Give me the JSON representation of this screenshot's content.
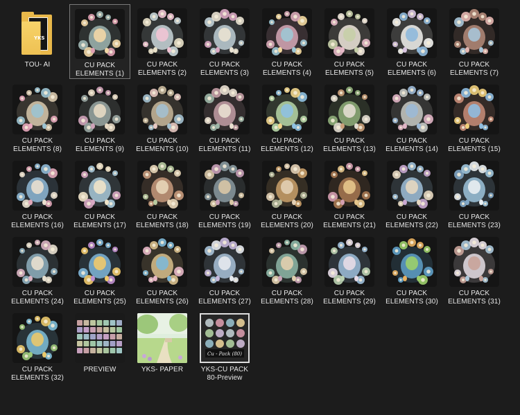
{
  "folder": {
    "items": [
      {
        "label": "TOU- AI",
        "type": "folder",
        "thumb": "folder-icon",
        "doc_text": "YKS"
      },
      {
        "label": "CU PACK\nELEMENTS  (1)",
        "type": "art",
        "thumb": "flower-boot-thumbnail",
        "selected": true,
        "colors": [
          "#9fb6b2",
          "#f2d7a6",
          "#e0a1b3"
        ]
      },
      {
        "label": "CU PACK\nELEMENTS  (2)",
        "type": "art",
        "thumb": "flower-vases-thumbnail",
        "colors": [
          "#c9d6d9",
          "#f0c4d4",
          "#e8e0c8"
        ]
      },
      {
        "label": "CU PACK\nELEMENTS  (3)",
        "type": "art",
        "thumb": "rocking-chair-thumbnail",
        "colors": [
          "#bfcfd6",
          "#e9e2d2",
          "#d9a8c3"
        ]
      },
      {
        "label": "CU PACK\nELEMENTS  (4)",
        "type": "art",
        "thumb": "flower-burst-thumbnail",
        "colors": [
          "#d7a8b7",
          "#9ec7d4",
          "#f3d9a0"
        ]
      },
      {
        "label": "CU PACK\nELEMENTS  (5)",
        "type": "art",
        "thumb": "flower-spray-thumbnail",
        "colors": [
          "#efe7dc",
          "#c6cfa8",
          "#e7b9c8"
        ]
      },
      {
        "label": "CU PACK\nELEMENTS  (6)",
        "type": "art",
        "thumb": "flower-bouquet-thumbnail",
        "colors": [
          "#f2f2ee",
          "#8fb9dc",
          "#d8c4e0"
        ]
      },
      {
        "label": "CU PACK\nELEMENTS  (7)",
        "type": "art",
        "thumb": "child-dragon-thumbnail",
        "colors": [
          "#b58b7a",
          "#a7c4d7",
          "#e4b6b0"
        ]
      },
      {
        "label": "CU PACK\nELEMENTS  (8)",
        "type": "art",
        "thumb": "easter-sign-thumbnail",
        "colors": [
          "#d9c9ae",
          "#9cc3d2",
          "#e8a9bd"
        ]
      },
      {
        "label": "CU PACK\nELEMENTS  (9)",
        "type": "art",
        "thumb": "umbrella-thumbnail",
        "colors": [
          "#9aa7a3",
          "#e7d9c4",
          "#cfa3b9"
        ]
      },
      {
        "label": "CU PACK\nELEMENTS  (10)",
        "type": "art",
        "thumb": "books-thumbnail",
        "colors": [
          "#c8b89c",
          "#a3c0cf",
          "#e5c7c0"
        ]
      },
      {
        "label": "CU PACK\nELEMENTS  (11)",
        "type": "art",
        "thumb": "flower-box-thumbnail",
        "colors": [
          "#c49ea6",
          "#e9dfd0",
          "#9fb7a8"
        ]
      },
      {
        "label": "CU PACK\nELEMENTS  (12)",
        "type": "art",
        "thumb": "dragon-egg-thumbnail",
        "colors": [
          "#b8d8a8",
          "#8fc1e0",
          "#f0d58c"
        ]
      },
      {
        "label": "CU PACK\nELEMENTS  (13)",
        "type": "art",
        "thumb": "tree-basket-thumbnail",
        "colors": [
          "#8fae7a",
          "#e2ddd0",
          "#caa07a"
        ]
      },
      {
        "label": "CU PACK\nELEMENTS  (14)",
        "type": "art",
        "thumb": "fountain-thumbnail",
        "colors": [
          "#c7c9c4",
          "#9cb9d6",
          "#dfb4c4"
        ]
      },
      {
        "label": "CU PACK\nELEMENTS  (15)",
        "type": "art",
        "thumb": "egg-stand-thumbnail",
        "colors": [
          "#c98e7a",
          "#8fbde0",
          "#f0cf7c"
        ]
      },
      {
        "label": "CU PACK\nELEMENTS  (16)",
        "type": "art",
        "thumb": "truck-thumbnail",
        "colors": [
          "#8fb9d6",
          "#e9dfcf",
          "#e0a6b8"
        ]
      },
      {
        "label": "CU PACK\nELEMENTS  (17)",
        "type": "art",
        "thumb": "candles-thumbnail",
        "colors": [
          "#a9c9d9",
          "#efe3c9",
          "#d7a7c2"
        ]
      },
      {
        "label": "CU PACK\nELEMENTS  (18)",
        "type": "art",
        "thumb": "mushroom-thumbnail",
        "colors": [
          "#c79a7c",
          "#e8d6b8",
          "#b7c9a0"
        ]
      },
      {
        "label": "CU PACK\nELEMENTS  (19)",
        "type": "art",
        "thumb": "bird-nest-thumbnail",
        "colors": [
          "#8a9aa0",
          "#d8c7a6",
          "#c8a0b8"
        ]
      },
      {
        "label": "CU PACK\nELEMENTS  (20)",
        "type": "art",
        "thumb": "tree-stump-thumbnail",
        "colors": [
          "#caa06a",
          "#e2cfb4",
          "#b2b89a"
        ]
      },
      {
        "label": "CU PACK\nELEMENTS  (21)",
        "type": "art",
        "thumb": "treasure-chest-thumbnail",
        "colors": [
          "#a87952",
          "#e6c68c",
          "#d49fb0"
        ]
      },
      {
        "label": "CU PACK\nELEMENTS  (22)",
        "type": "art",
        "thumb": "hourglass-thumbnail",
        "colors": [
          "#9fc0d8",
          "#e5d7c0",
          "#c8a8d0"
        ]
      },
      {
        "label": "CU PACK\nELEMENTS  (23)",
        "type": "art",
        "thumb": "piano-thumbnail",
        "colors": [
          "#9dc4dc",
          "#e9eef2",
          "#7fa5c4"
        ]
      },
      {
        "label": "CU PACK\nELEMENTS  (24)",
        "type": "art",
        "thumb": "window-thumbnail",
        "colors": [
          "#8fb0c0",
          "#e8e0cf",
          "#d9b2c2"
        ]
      },
      {
        "label": "CU PACK\nELEMENTS  (25)",
        "type": "art",
        "thumb": "baby-dragon-thumbnail",
        "colors": [
          "#7fb6d8",
          "#f0c96b",
          "#c08fd0"
        ]
      },
      {
        "label": "CU PACK\nELEMENTS  (26)",
        "type": "art",
        "thumb": "scroll-frame-thumbnail",
        "colors": [
          "#d8bf8c",
          "#7fb8d6",
          "#e7b7c6"
        ]
      },
      {
        "label": "CU PACK\nELEMENTS  (27)",
        "type": "art",
        "thumb": "castle-thumbnail",
        "colors": [
          "#a9c3d9",
          "#e6e9ee",
          "#c7b8dc"
        ]
      },
      {
        "label": "CU PACK\nELEMENTS  (28)",
        "type": "art",
        "thumb": "small-book-thumbnail",
        "colors": [
          "#8fb8a8",
          "#e1cfae",
          "#c9a3b7"
        ]
      },
      {
        "label": "CU PACK\nELEMENTS  (29)",
        "type": "art",
        "thumb": "gem-flowers-thumbnail",
        "colors": [
          "#9ec0dc",
          "#e7dbe7",
          "#b9d0b0"
        ]
      },
      {
        "label": "CU PACK\nELEMENTS  (30)",
        "type": "art",
        "thumb": "dragon-eye-thumbnail",
        "colors": [
          "#5fa0c8",
          "#9ccf6a",
          "#e8b060"
        ]
      },
      {
        "label": "CU PACK\nELEMENTS  (31)",
        "type": "art",
        "thumb": "bunny-child-thumbnail",
        "colors": [
          "#e8dfe6",
          "#c9a39a",
          "#aac6d9"
        ]
      },
      {
        "label": "CU PACK\nELEMENTS  (32)",
        "type": "art",
        "thumb": "fairy-thumbnail",
        "colors": [
          "#7fbfd8",
          "#e9c86c",
          "#9cc77a"
        ]
      },
      {
        "label": "PREVIEW",
        "type": "preview-grid",
        "thumb": "preview-grid-thumbnail"
      },
      {
        "label": "YKS-  PAPER",
        "type": "photo",
        "thumb": "paper-meadow-thumbnail"
      },
      {
        "label": "YKS-CU PACK\n80-Preview",
        "type": "framed",
        "thumb": "pack-preview-thumbnail"
      }
    ]
  }
}
